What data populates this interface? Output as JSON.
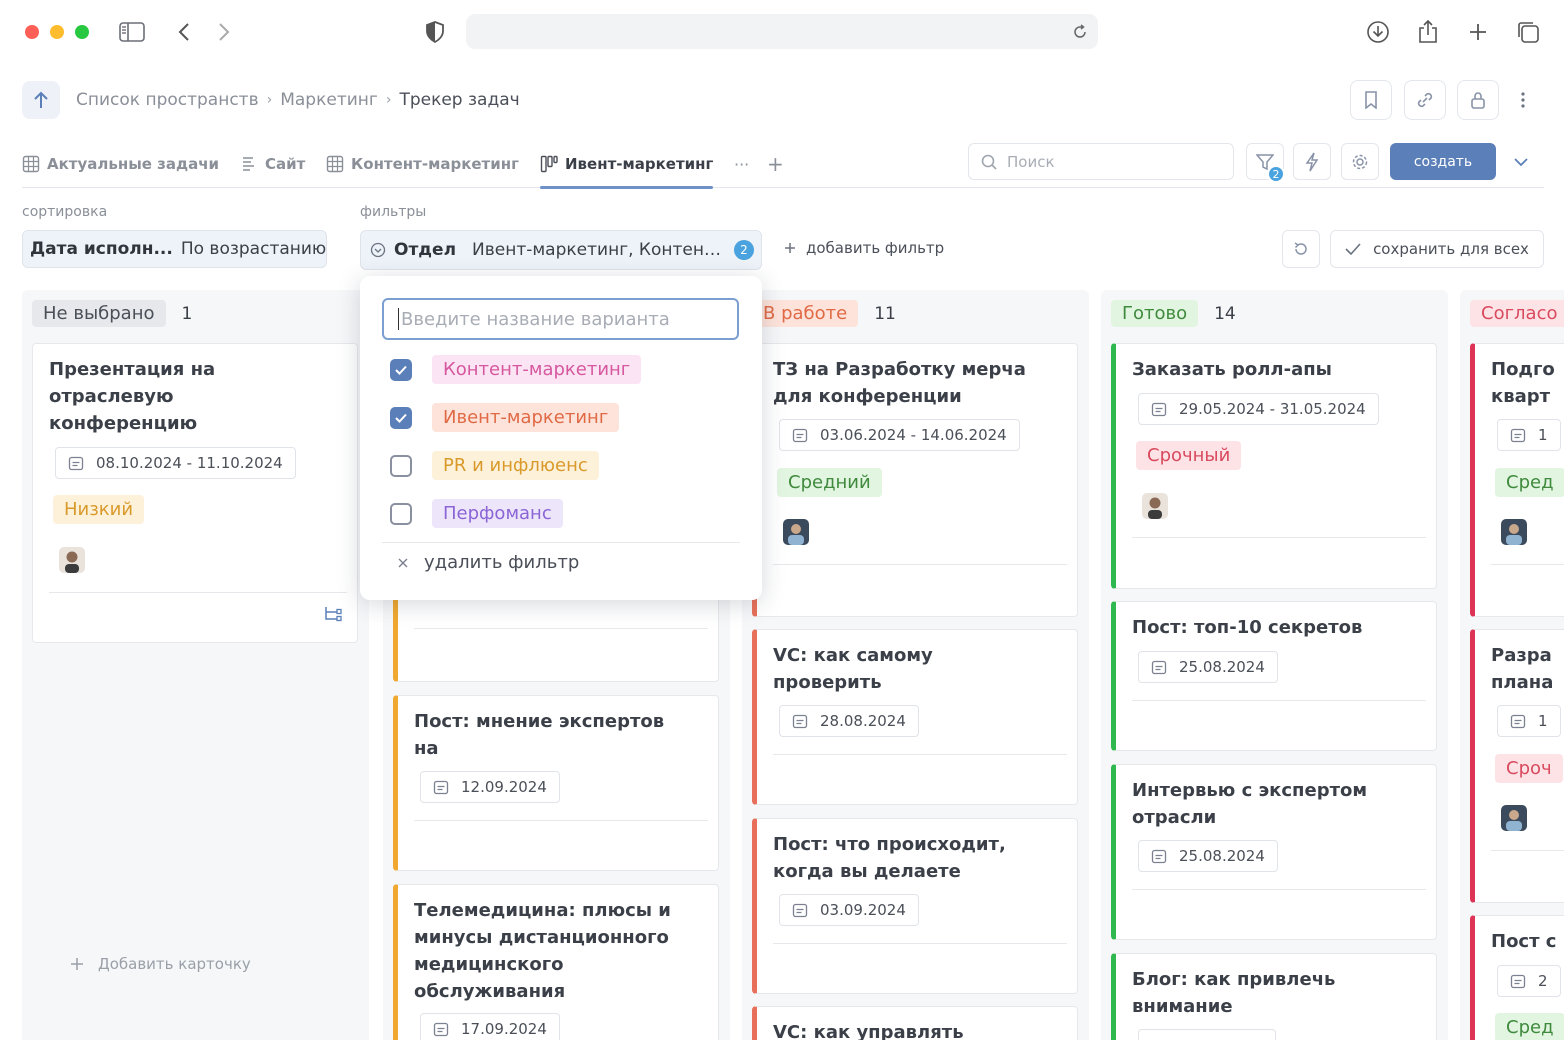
{
  "header": {
    "breadcrumb": [
      "Список пространств",
      "Маркетинг",
      "Трекер задач"
    ]
  },
  "tabs": [
    {
      "label": "Актуальные задачи",
      "icon": "table-icon"
    },
    {
      "label": "Сайт",
      "icon": "list-icon"
    },
    {
      "label": "Контент-маркетинг",
      "icon": "table-icon"
    },
    {
      "label": "Ивент-маркетинг",
      "icon": "kanban-icon",
      "active": true
    }
  ],
  "toolbar": {
    "more": "···",
    "add": "+",
    "search_placeholder": "Поиск",
    "filter_count": "2",
    "create_label": "создать"
  },
  "sorting": {
    "label": "сортировка",
    "field": "Дата исполн...",
    "order": "По возрастанию"
  },
  "filters": {
    "label": "фильтры",
    "field": "Отдел",
    "value": "Ивент-маркетинг, Контент...",
    "count": "2",
    "add_label": "добавить фильтр",
    "save_label": "сохранить для всех"
  },
  "dropdown": {
    "placeholder": "Введите название варианта",
    "options": [
      {
        "label": "Контент-маркетинг",
        "checked": true,
        "bg": "#fbe4f3",
        "fg": "#d6589f"
      },
      {
        "label": "Ивент-маркетинг",
        "checked": true,
        "bg": "#fde3da",
        "fg": "#e06a45"
      },
      {
        "label": "PR и инфлюенс",
        "checked": false,
        "bg": "#fdf1da",
        "fg": "#d99a2b"
      },
      {
        "label": "Перфоманс",
        "checked": false,
        "bg": "#ede6fb",
        "fg": "#8b64d6"
      }
    ],
    "remove_label": "удалить фильтр"
  },
  "columns": [
    {
      "name": "Не выбрано",
      "count": "1",
      "bg": "#e6e8ec",
      "fg": "#4a4f58",
      "cards": [
        {
          "title": [
            "Презентация на",
            "отраслевую",
            "конференцию"
          ],
          "date": "08.10.2024 - 11.10.2024",
          "priority": "Низкий"
        }
      ],
      "add_card": "Добавить карточку"
    },
    {
      "name": "В работе",
      "count": "11",
      "bg": "#fde3da",
      "fg": "#e06a45",
      "cards": [
        {
          "title": [
            "ТЗ на Разработку мерча",
            "для конференции"
          ],
          "date": "03.06.2024 - 14.06.2024",
          "priority": "Средний"
        },
        {
          "title": [
            "VC: как самому",
            "проверить"
          ],
          "date": "28.08.2024"
        },
        {
          "title": [
            "Пост: что происходит,",
            "когда вы делаете"
          ],
          "date": "03.09.2024"
        },
        {
          "title": [
            "VC: как управлять"
          ]
        }
      ]
    },
    {
      "name": "Готово",
      "count": "14",
      "bg": "#e2f5e1",
      "fg": "#3f8a3d",
      "cards": [
        {
          "title": [
            "Заказать ролл-апы"
          ],
          "date": "29.05.2024 - 31.05.2024",
          "priority": "Срочный"
        },
        {
          "title": [
            "Пост: топ-10 секретов"
          ],
          "date": "25.08.2024"
        },
        {
          "title": [
            "Интервью с экспертом",
            "отрасли"
          ],
          "date": "25.08.2024"
        },
        {
          "title": [
            "Блог: как привлечь",
            "внимание"
          ]
        }
      ]
    },
    {
      "name": "Согласо",
      "bg": "#fde3e6",
      "fg": "#d94a5e",
      "cards": [
        {
          "title": [
            "Подго",
            "кварт"
          ],
          "date": "1",
          "priority": "Сред"
        },
        {
          "title": [
            "Разра",
            "плана"
          ],
          "date": "1",
          "priority": "Сроч"
        },
        {
          "title": [
            "Пост с"
          ],
          "date": "2",
          "priority": "Сред"
        }
      ]
    }
  ],
  "middle_column": {
    "cards": [
      {
        "title": [
          "Пост: мнение экспертов",
          "на"
        ],
        "date": "12.09.2024"
      },
      {
        "title": [
          "Телемедицина: плюсы и",
          "минусы дистанционного",
          "медицинского",
          "обслуживания"
        ],
        "date": "17.09.2024"
      }
    ]
  },
  "priority_colors": {
    "Низкий": {
      "bg": "#fdf1da",
      "fg": "#d99a2b"
    },
    "Средний": {
      "bg": "#e2f5e1",
      "fg": "#3f8a3d"
    },
    "Срочный": {
      "bg": "#fde3e6",
      "fg": "#d94a5e"
    }
  },
  "accents": {
    "orange": "#f0a830",
    "salmon": "#e8705a",
    "green": "#2eb84f",
    "red": "#dd3355",
    "primary": "#5b7fb8"
  }
}
